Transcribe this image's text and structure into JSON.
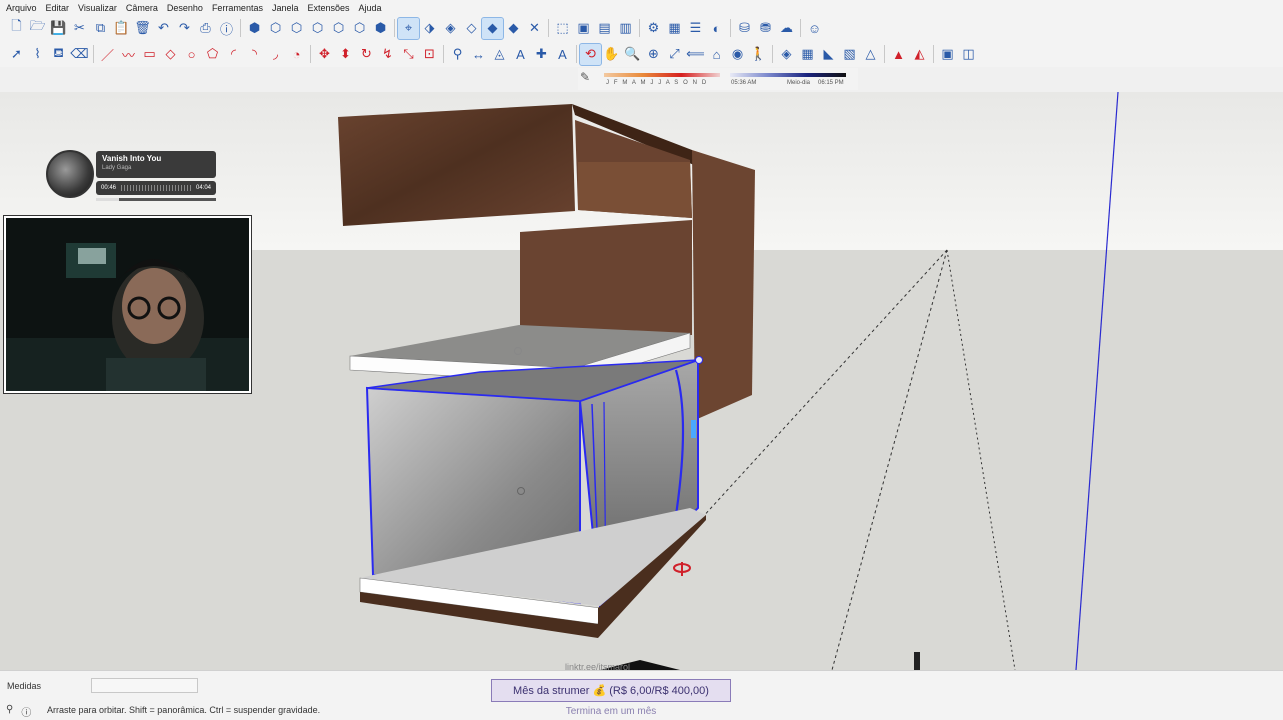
{
  "menu": [
    "Arquivo",
    "Editar",
    "Visualizar",
    "Câmera",
    "Desenho",
    "Ferramentas",
    "Janela",
    "Extensões",
    "Ajuda"
  ],
  "toolbar_row1": [
    "new-file",
    "open-file",
    "save",
    "cut",
    "copy",
    "paste",
    "erase",
    "undo",
    "redo",
    "print",
    "model-info",
    "sep",
    "iso-view",
    "top-view",
    "front-view",
    "right-view",
    "back-view",
    "left-view",
    "bottom-view",
    "sep",
    "xray",
    "back-edges",
    "wireframe",
    "hidden-line",
    "shaded",
    "shaded-textures",
    "monochrome",
    "sep",
    "section-plane",
    "section-display",
    "section-cut",
    "section-fill",
    "sep",
    "components",
    "groups",
    "layers",
    "styles",
    "sep",
    "warehouse",
    "extension-warehouse",
    "sketchup-text",
    "sep",
    "account"
  ],
  "toolbar_row2": [
    "select",
    "lasso",
    "paint-bucket",
    "eraser",
    "sep",
    "line",
    "freehand",
    "rectangle",
    "rotated-rectangle",
    "circle",
    "polygon",
    "arc",
    "2pt-arc",
    "3pt-arc",
    "pie",
    "sep",
    "move",
    "push-pull",
    "rotate",
    "follow-me",
    "scale",
    "offset",
    "sep",
    "tape-measure",
    "dimension",
    "protractor",
    "text",
    "axes",
    "3d-text",
    "sep",
    "orbit",
    "pan",
    "zoom",
    "zoom-window",
    "zoom-extents",
    "previous",
    "position-camera",
    "look-around",
    "walk",
    "sep",
    "sandbox-from-contours",
    "sandbox-scratch",
    "smoove",
    "stamp",
    "drape",
    "sep",
    "solid-tools",
    "intersect",
    "sep",
    "outer-shell",
    "trim"
  ],
  "shadow": {
    "months": "J F M A M J J A S O N D",
    "time_start": "05:36 AM",
    "time_mid": "Meio-dia",
    "time_end": "06:15 PM"
  },
  "music": {
    "title": "Vanish Into You",
    "artist": "Lady Gaga",
    "elapsed": "00:46",
    "duration": "04:04",
    "progress": 0.19
  },
  "overlay_handle": "linktr.ee/itsmarol",
  "status": {
    "measure_label": "Medidas",
    "measure_value": "",
    "hint": "Arraste para orbitar. Shift = panorâmica. Ctrl = suspender gravidade."
  },
  "sub_goal": {
    "label": "Mês da strumer 💰 (R$ 6,00/R$ 400,00)",
    "sub_label": "Termina em um mês",
    "current": 6.0,
    "target": 400.0
  },
  "colors": {
    "wood": "#5a3a26",
    "selection": "#2a2af0",
    "horizon_sky": "#f4f4f2",
    "ground": "#d9d9d5"
  }
}
